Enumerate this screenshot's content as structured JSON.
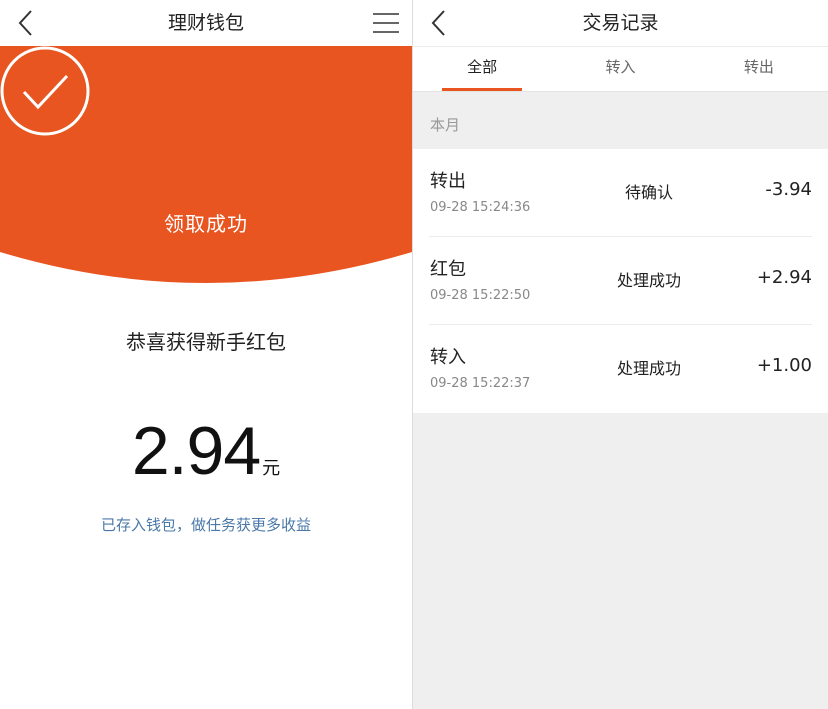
{
  "colors": {
    "accent": "#E85520",
    "link": "#4A78A8",
    "page_bg": "#EFEFEF"
  },
  "left": {
    "title": "理财钱包",
    "back_icon": "chevron-left-icon",
    "menu_icon": "hamburger-menu-icon",
    "hero": {
      "icon": "check-circle-icon",
      "text": "领取成功"
    },
    "congrats": "恭喜获得新手红包",
    "amount": "2.94",
    "unit": "元",
    "note": "已存入钱包，做任务获更多收益"
  },
  "right": {
    "title": "交易记录",
    "back_icon": "chevron-left-icon",
    "tabs": [
      {
        "label": "全部",
        "active": true
      },
      {
        "label": "转入",
        "active": false
      },
      {
        "label": "转出",
        "active": false
      }
    ],
    "month_label": "本月",
    "transactions": [
      {
        "type": "转出",
        "time": "09-28 15:24:36",
        "status": "待确认",
        "amount": "-3.94"
      },
      {
        "type": "红包",
        "time": "09-28 15:22:50",
        "status": "处理成功",
        "amount": "+2.94"
      },
      {
        "type": "转入",
        "time": "09-28 15:22:37",
        "status": "处理成功",
        "amount": "+1.00"
      }
    ]
  }
}
